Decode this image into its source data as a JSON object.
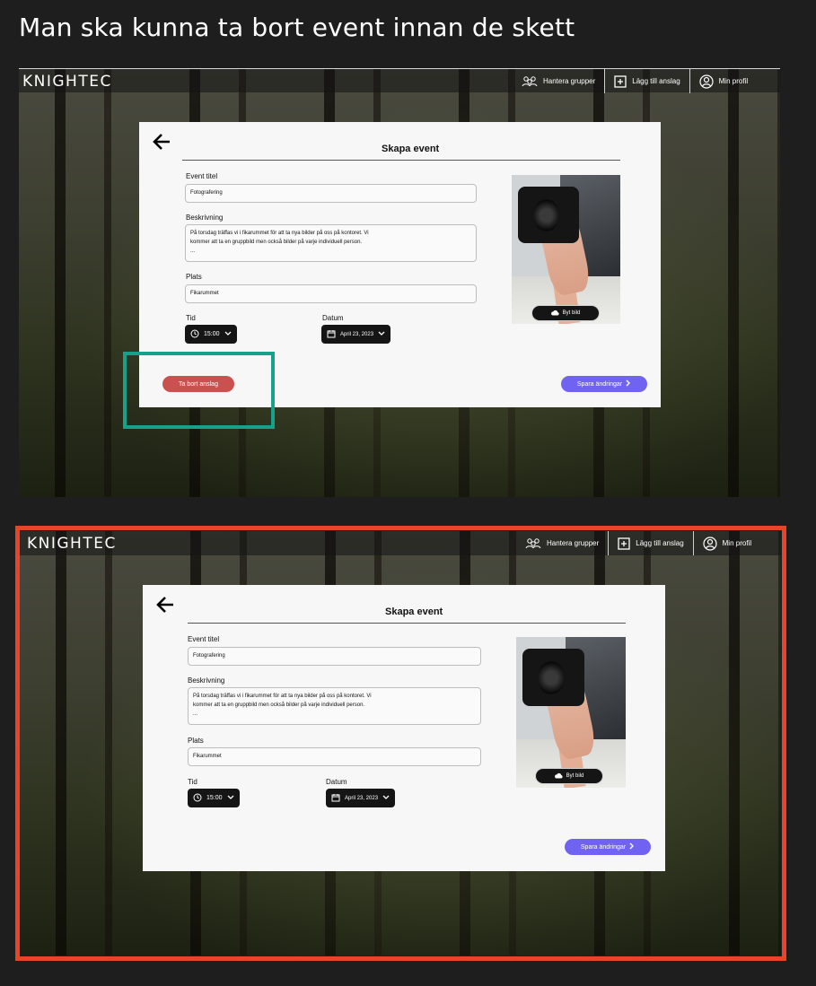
{
  "heading": "Man ska kunna ta bort event innan de skett",
  "app": {
    "logo": "KNIGHTEC",
    "nav": [
      {
        "label": "Hantera grupper",
        "icon": "group-icon"
      },
      {
        "label": "Lägg till anslag",
        "icon": "add-box-icon"
      },
      {
        "label": "Min profil",
        "icon": "profile-icon"
      }
    ]
  },
  "form": {
    "title": "Skapa event",
    "event_title_label": "Event titel",
    "event_title_value": "Fotografering",
    "description_label": "Beskrivning",
    "description_line1": "På torsdag träffas vi i fikarummet för att ta nya bilder på oss på kontoret. Vi",
    "description_line2": "kommer att ta en gruppbild men också bilder på varje individuell person.",
    "description_line3": "...",
    "place_label": "Plats",
    "place_value": "Fikarummet",
    "time_label": "Tid",
    "time_value": "15:00",
    "date_label": "Datum",
    "date_value": "April 23, 2023",
    "change_image": "Byt bild",
    "save_button": "Spara ändringar",
    "delete_button": "Ta bort anslag"
  },
  "colors": {
    "save": "#7063f2",
    "delete": "#c9514f",
    "highlight_green": "#17a08a",
    "highlight_red": "#e8442c"
  }
}
